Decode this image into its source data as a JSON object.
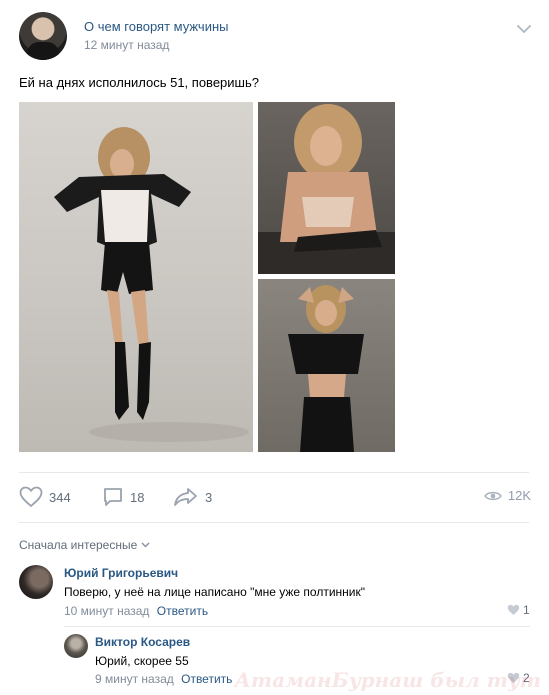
{
  "post": {
    "group_name": "О чем говорят мужчины",
    "time": "12 минут назад",
    "text": "Ей на днях исполнилось 51, поверишь?",
    "stats": {
      "likes": "344",
      "comments": "18",
      "shares": "3",
      "views": "12K"
    }
  },
  "comments": {
    "sort_label": "Сначала интересные",
    "items": [
      {
        "author": "Юрий Григорьевич",
        "text": "Поверю, у неё на лице написано \"мне уже полтинник\"",
        "time": "10 минут назад",
        "reply_label": "Ответить",
        "likes": "1"
      },
      {
        "author": "Виктор Косарев",
        "text": "Юрий, скорее 55",
        "time": "9 минут назад",
        "reply_label": "Ответить",
        "likes": "2"
      }
    ]
  },
  "watermark": "АтаманБурнаш был тут",
  "colors": {
    "link": "#2a5885",
    "meta": "#818c99",
    "icon": "#99a2ad"
  }
}
